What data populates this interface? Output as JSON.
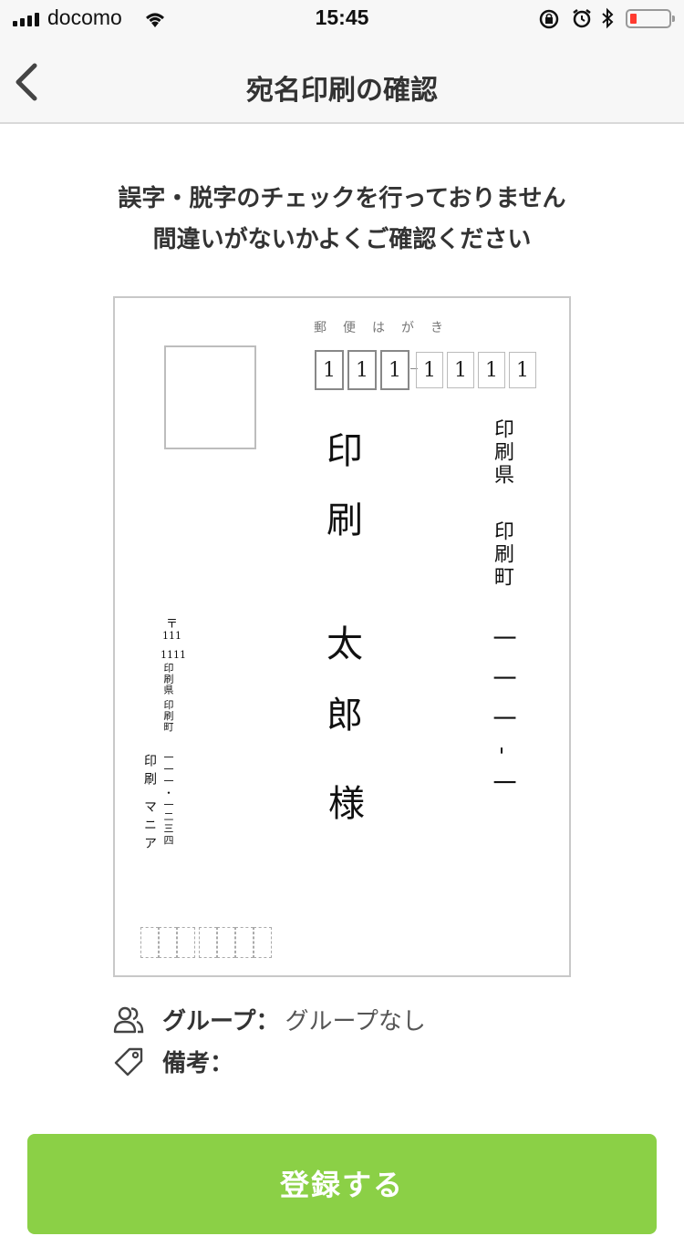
{
  "status_bar": {
    "carrier": "docomo",
    "time": "15:45",
    "battery_color": "#ff3b30"
  },
  "nav": {
    "title": "宛名印刷の確認",
    "back_icon": "chevron-left-icon"
  },
  "notice": {
    "line1": "誤字・脱字のチェックを行っておりません",
    "line2": "間違いがないかよくご確認ください"
  },
  "postcard": {
    "label": "郵便はがき",
    "zip_digits": [
      "1",
      "1",
      "1",
      "1",
      "1",
      "1",
      "1"
    ],
    "address_line1": "印刷県",
    "address_line2": "印刷町",
    "address_number": "一一一-一",
    "recipient_last": "印刷",
    "recipient_first": "太郎",
    "honorific": "様",
    "sender": {
      "zip_mark": "〒",
      "zip1": "111",
      "zip2": "1111",
      "address": "印刷県 印刷町",
      "number": "一一一・一二三四",
      "name": "印刷 マニア"
    }
  },
  "info": {
    "group_label": "グループ：",
    "group_value": "グループなし",
    "note_label": "備考："
  },
  "register_button": {
    "label": "登録する",
    "color": "#8bd046"
  }
}
